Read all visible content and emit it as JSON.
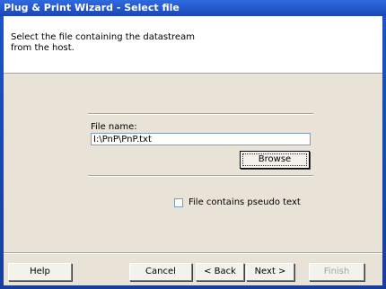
{
  "window": {
    "title": "Plug & Print Wizard - Select file"
  },
  "header": {
    "instruction": "Select the file containing the datastream from the host."
  },
  "form": {
    "file_label": "File name:",
    "file_value": "I:\\PnP\\PnP.txt",
    "browse_label": "Browse",
    "pseudo_text_label": "File contains pseudo text",
    "pseudo_text_checked": false
  },
  "footer": {
    "help_label": "Help",
    "cancel_label": "Cancel",
    "back_label": "< Back",
    "next_label": "Next >",
    "finish_label": "Finish"
  }
}
